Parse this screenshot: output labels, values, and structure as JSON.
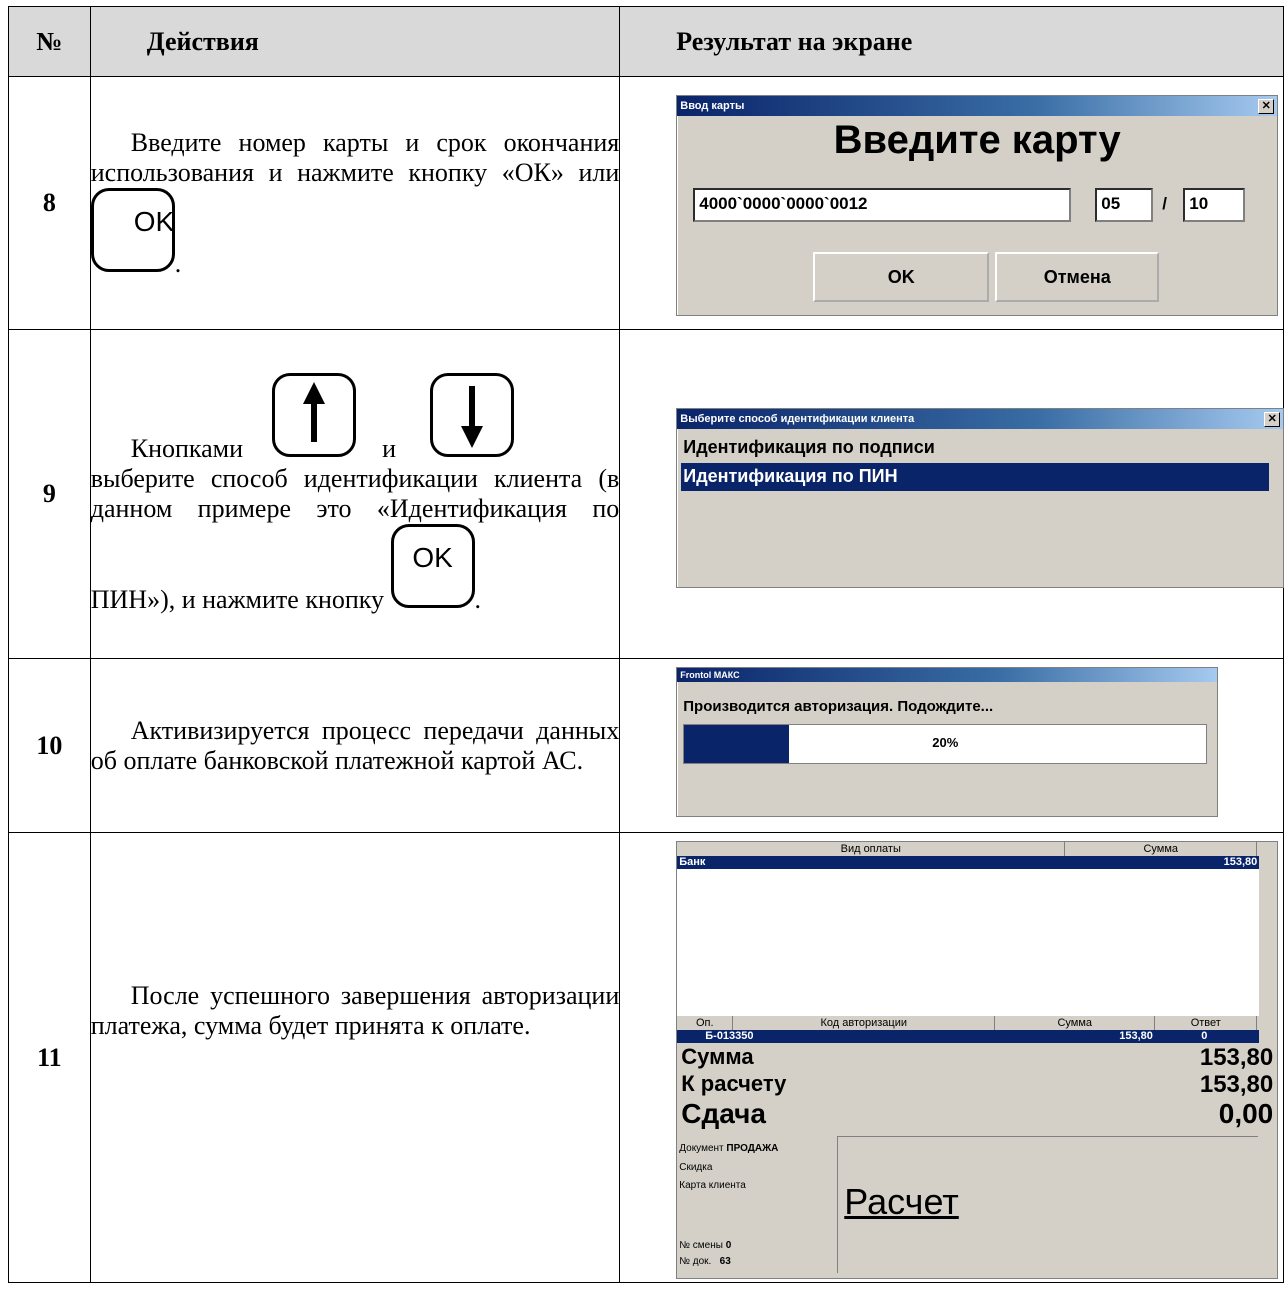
{
  "headers": {
    "num": "№",
    "actions": "Действия",
    "result": "Результат на экране"
  },
  "rows": [
    {
      "num": "8",
      "action_text": "Введите номер карты и срок окончания использования и нажмите кнопку «ОК» или",
      "key_ok": "OK",
      "dialog": {
        "title": "Ввод карты",
        "heading": "Введите карту",
        "card_number": "4000`0000`0000`0012",
        "month": "05",
        "separator": "/",
        "year": "10",
        "ok": "OK",
        "cancel": "Отмена"
      }
    },
    {
      "num": "9",
      "action_prefix": "Кнопками",
      "action_mid": "и",
      "action_text": "выберите способ идентификации клиента (в данном примере это «Идентификация по ПИН»), и нажмите кнопку",
      "key_ok": "OK",
      "dialog": {
        "title": "Выберите способ идентификации клиента",
        "options": [
          "Идентификация по подписи",
          "Идентификация по ПИН"
        ]
      }
    },
    {
      "num": "10",
      "action_text": "Активизируется процесс передачи данных об оплате банковской платежной картой АС.",
      "dialog": {
        "title": "Frontol МАКС",
        "message": "Производится авторизация. Подождите...",
        "progress_label": "20%",
        "progress": 0.2
      }
    },
    {
      "num": "11",
      "action_text": "После успешного завершения авторизации платежа, сумма будет принята к оплате.",
      "screen": {
        "pay_header_type": "Вид оплаты",
        "pay_header_sum": "Сумма",
        "pay_row_type": "Банк",
        "pay_row_sum": "153,80",
        "auth_header_op": "Оп.",
        "auth_header_code": "Код авторизации",
        "auth_header_sum": "Сумма",
        "auth_header_answer": "Ответ",
        "auth_row_op": "Б-013350",
        "auth_row_sum": "153,80",
        "auth_row_answer": "0",
        "sum_label": "Сумма",
        "sum_value": "153,80",
        "topay_label": "К расчету",
        "topay_value": "153,80",
        "change_label": "Сдача",
        "change_value": "0,00",
        "doc_label": "Документ",
        "doc_value": "ПРОДАЖА",
        "discount_label": "Скидка",
        "card_label": "Карта клиента",
        "shift_label": "№ смены",
        "shift_value": "0",
        "docnum_label": "№ док.",
        "docnum_value": "63",
        "mode": "Расчет"
      }
    }
  ]
}
